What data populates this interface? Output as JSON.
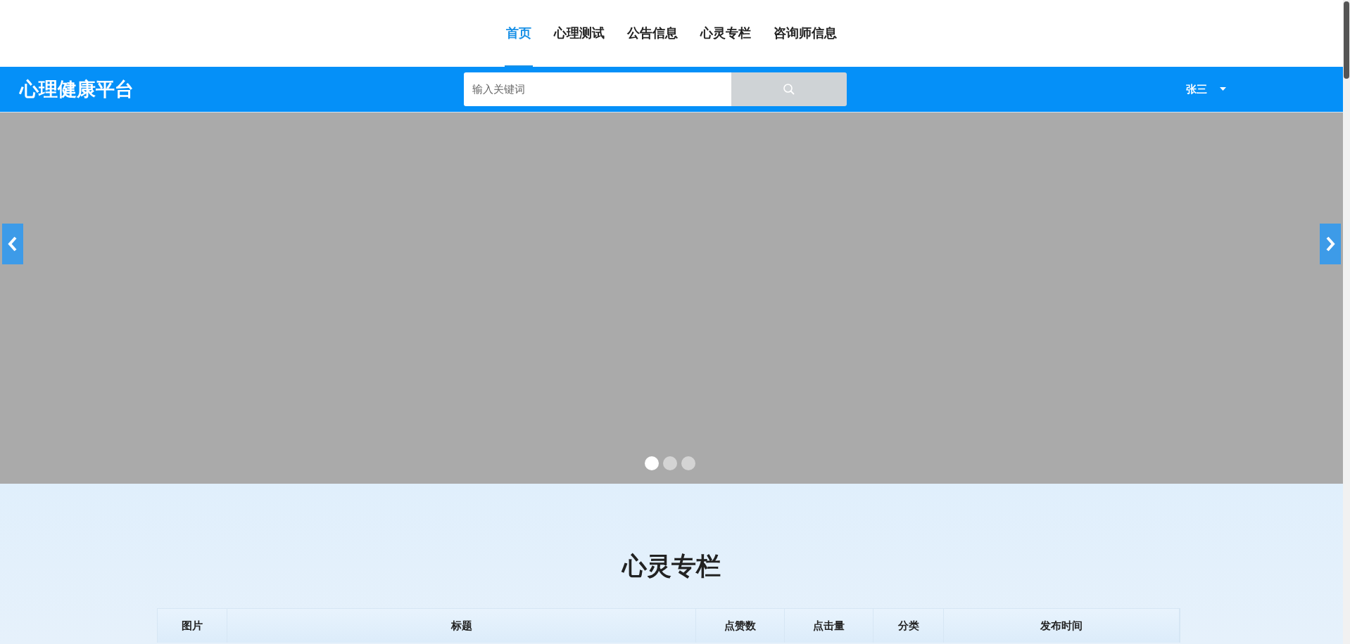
{
  "nav": {
    "tabs": [
      {
        "label": "首页",
        "selected": true
      },
      {
        "label": "心理测试",
        "selected": false
      },
      {
        "label": "公告信息",
        "selected": false
      },
      {
        "label": "心灵专栏",
        "selected": false
      },
      {
        "label": "咨询师信息",
        "selected": false
      }
    ]
  },
  "header": {
    "logo": "心理健康平台",
    "search": {
      "placeholder": "输入关键词"
    },
    "user": "张三"
  },
  "carousel": {
    "slides": [
      {
        "selected": true
      },
      {
        "selected": false
      },
      {
        "selected": false
      }
    ]
  },
  "section": {
    "title": "心灵专栏",
    "table": {
      "columns": [
        "图片",
        "标题",
        "点赞数",
        "点击量",
        "分类",
        "发布时间"
      ]
    }
  }
}
